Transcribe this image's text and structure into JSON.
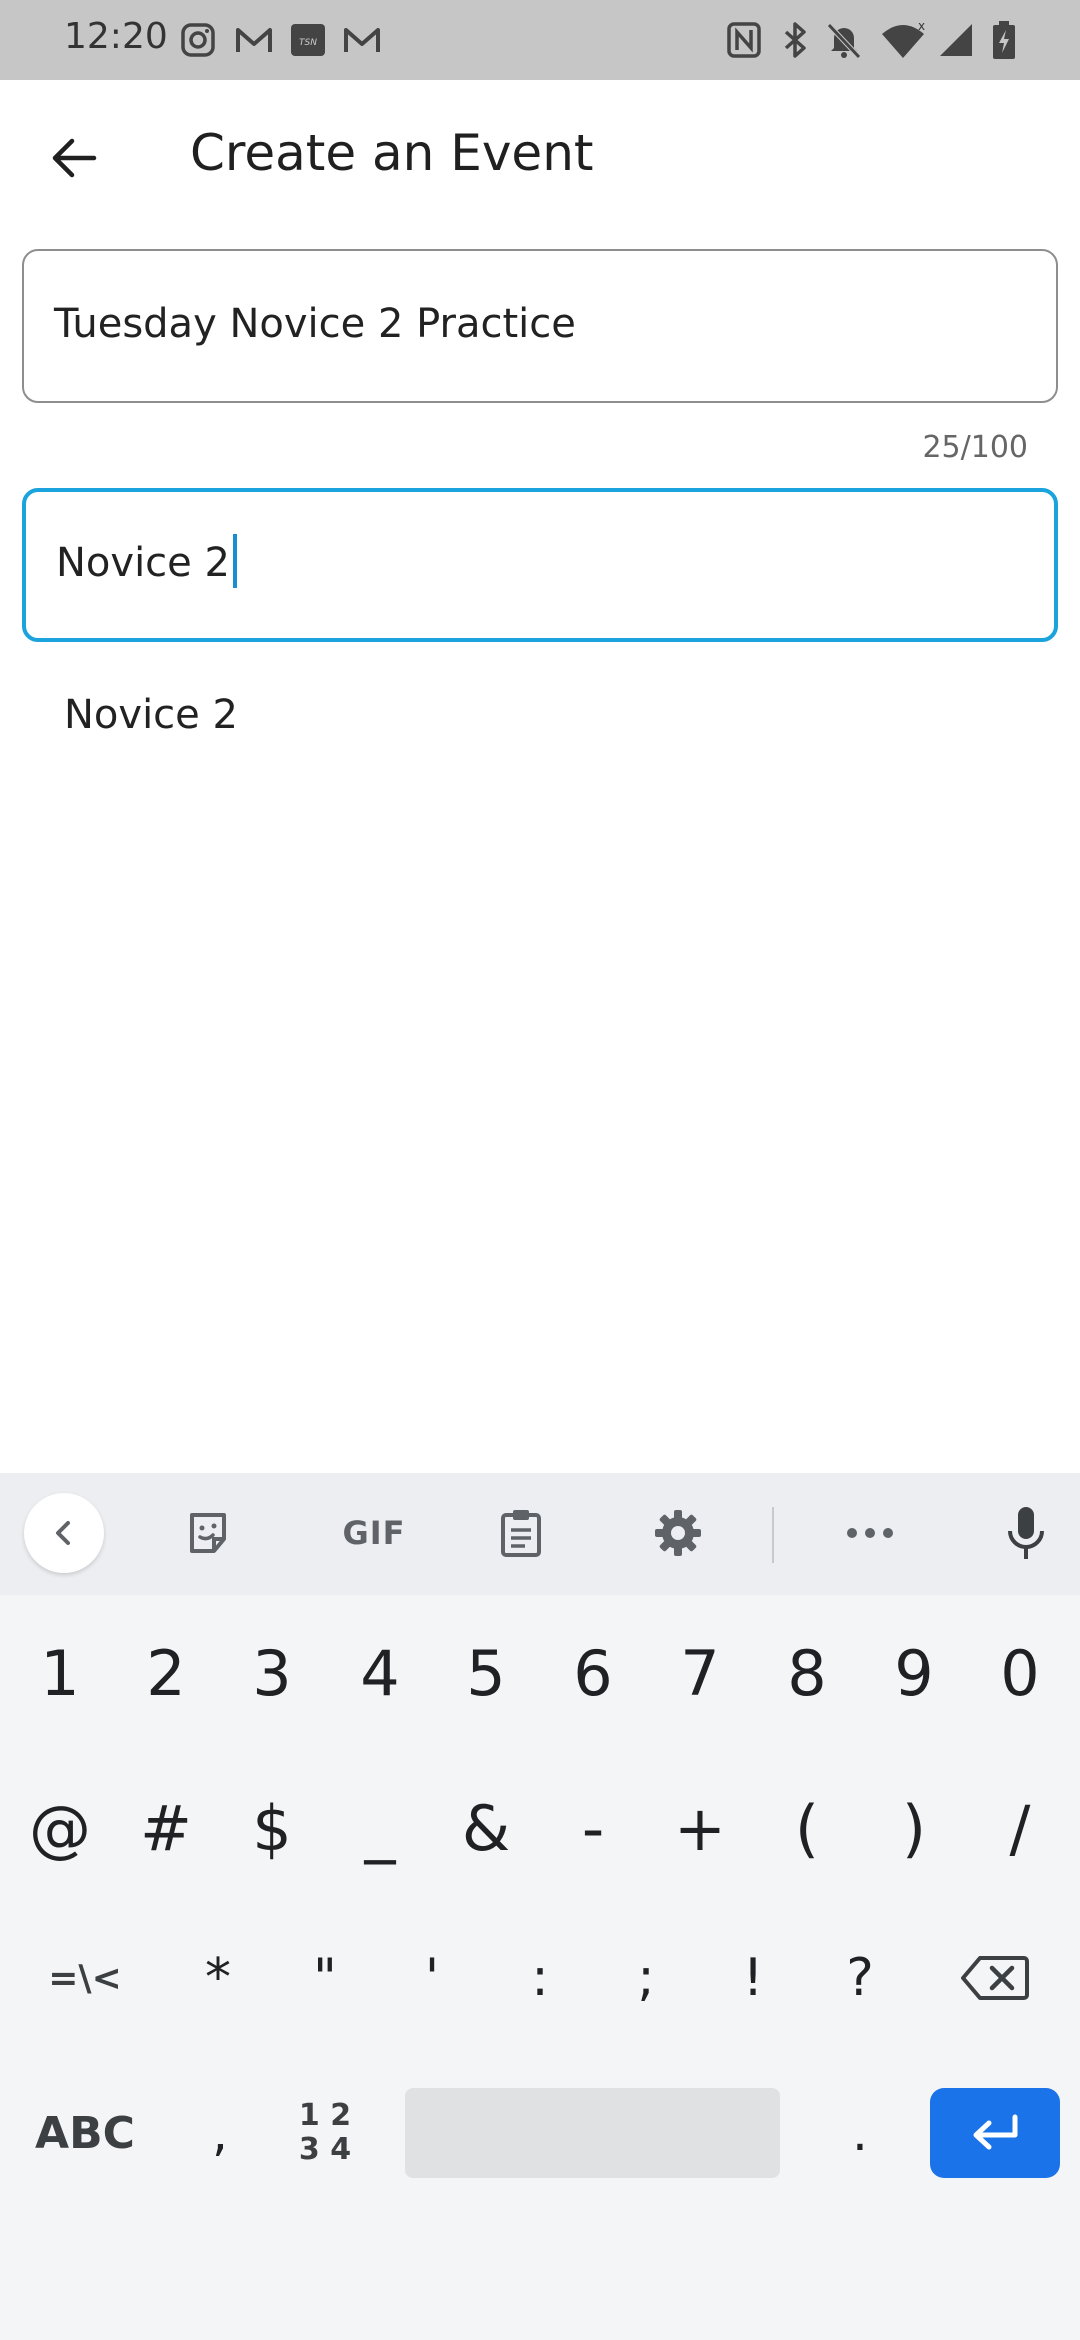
{
  "status_bar": {
    "time": "12:20",
    "notification_icons": [
      "instagram-icon",
      "gmail-icon",
      "tsn-icon",
      "gmail-icon"
    ],
    "system_icons": [
      "nfc-icon",
      "bluetooth-icon",
      "mute-icon",
      "wifi-icon",
      "signal-icon",
      "battery-icon"
    ]
  },
  "app_bar": {
    "title": "Create an Event",
    "back_icon": "back-arrow-icon"
  },
  "form": {
    "event_name": {
      "value": "Tuesday Novice 2 Practice",
      "counter": "25/100"
    },
    "group_field": {
      "value": "Novice 2"
    },
    "suggestions": [
      "Novice 2"
    ]
  },
  "keyboard": {
    "toolbar": {
      "collapse_icon": "chevron-left-icon",
      "sticker_icon": "sticker-icon",
      "gif_label": "GIF",
      "clipboard_icon": "clipboard-icon",
      "settings_icon": "gear-icon",
      "more_icon": "more-horizontal-icon",
      "mic_icon": "mic-icon"
    },
    "row_numbers": [
      "1",
      "2",
      "3",
      "4",
      "5",
      "6",
      "7",
      "8",
      "9",
      "0"
    ],
    "row_symbols": [
      "@",
      "#",
      "$",
      "_",
      "&",
      "-",
      "+",
      "(",
      ")",
      "/"
    ],
    "row_three": [
      "=\\<",
      "*",
      "\"",
      "'",
      ":",
      ";",
      "!",
      "?"
    ],
    "abc_label": "ABC",
    "comma_label": ",",
    "numpad_label_top": "1 2",
    "numpad_label_bottom": "3 4",
    "period_label": ".",
    "accent_color": "#1a73e8",
    "focus_color": "#1aa3dc"
  }
}
